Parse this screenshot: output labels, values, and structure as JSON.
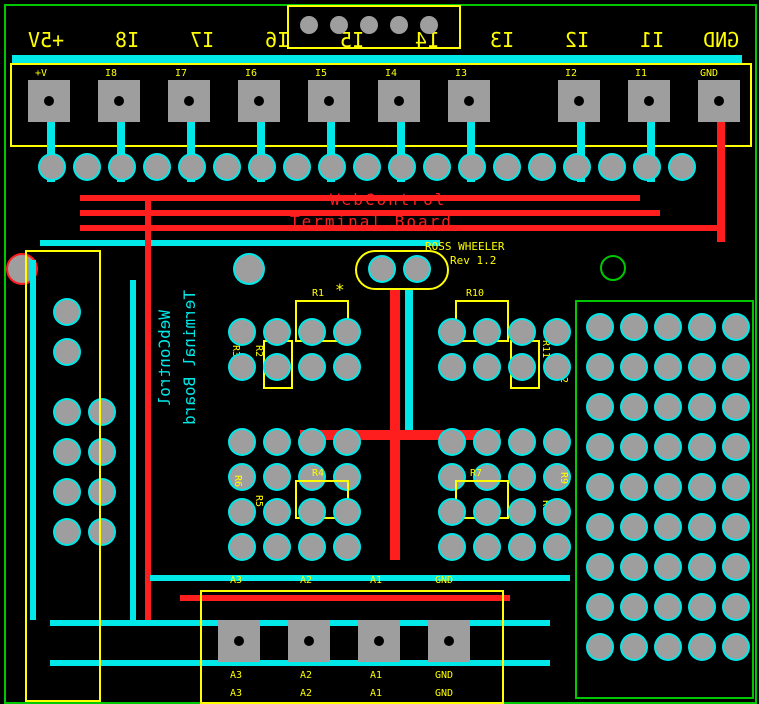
{
  "board": {
    "title1": "WebControl",
    "title2": "Terminal Board",
    "author": "ROSS WHEELER",
    "revision": "Rev 1.2",
    "side_title1": "WebControl",
    "side_title2": "Terminal Board"
  },
  "top_labels_mirrored": [
    "GND",
    "I1",
    "I2",
    "I3",
    "I4",
    "I5",
    "I6",
    "I7",
    "I8",
    "+5V"
  ],
  "top_terminal_labels": [
    "GND",
    "I1",
    "I2",
    "I3",
    "I4",
    "I5",
    "I6",
    "I7",
    "I8",
    "+V"
  ],
  "bottom_terminals_top": [
    "A3",
    "A2",
    "A1",
    "GND"
  ],
  "bottom_terminals_bot": [
    "A3",
    "A2",
    "A1",
    "GND"
  ],
  "bottom_yellow_labels": [
    "A3",
    "A2",
    "A1",
    "GND"
  ],
  "resistors": [
    "R1",
    "R2",
    "R3",
    "R4",
    "R5",
    "R6",
    "R7",
    "R8",
    "R9",
    "R10",
    "R11",
    "R12"
  ],
  "asterisk": "*",
  "chart_data": {
    "type": "diagram",
    "description": "PCB layout for WebControl Terminal Board Rev 1.2",
    "layers": [
      "top-copper (red)",
      "bottom-copper (cyan)",
      "silkscreen (yellow)",
      "outline (green)",
      "pads (grey)"
    ],
    "terminals_top": [
      "GND",
      "I1",
      "I2",
      "I3",
      "I4",
      "I5",
      "I6",
      "I7",
      "I8",
      "+5V"
    ],
    "terminals_bottom": [
      "A3",
      "A2",
      "A1",
      "GND"
    ],
    "components": [
      "R1",
      "R2",
      "R3",
      "R4",
      "R5",
      "R6",
      "R7",
      "R8",
      "R9",
      "R10",
      "R11",
      "R12"
    ],
    "proto_area_grid": {
      "cols": 5,
      "rows": 9
    }
  }
}
